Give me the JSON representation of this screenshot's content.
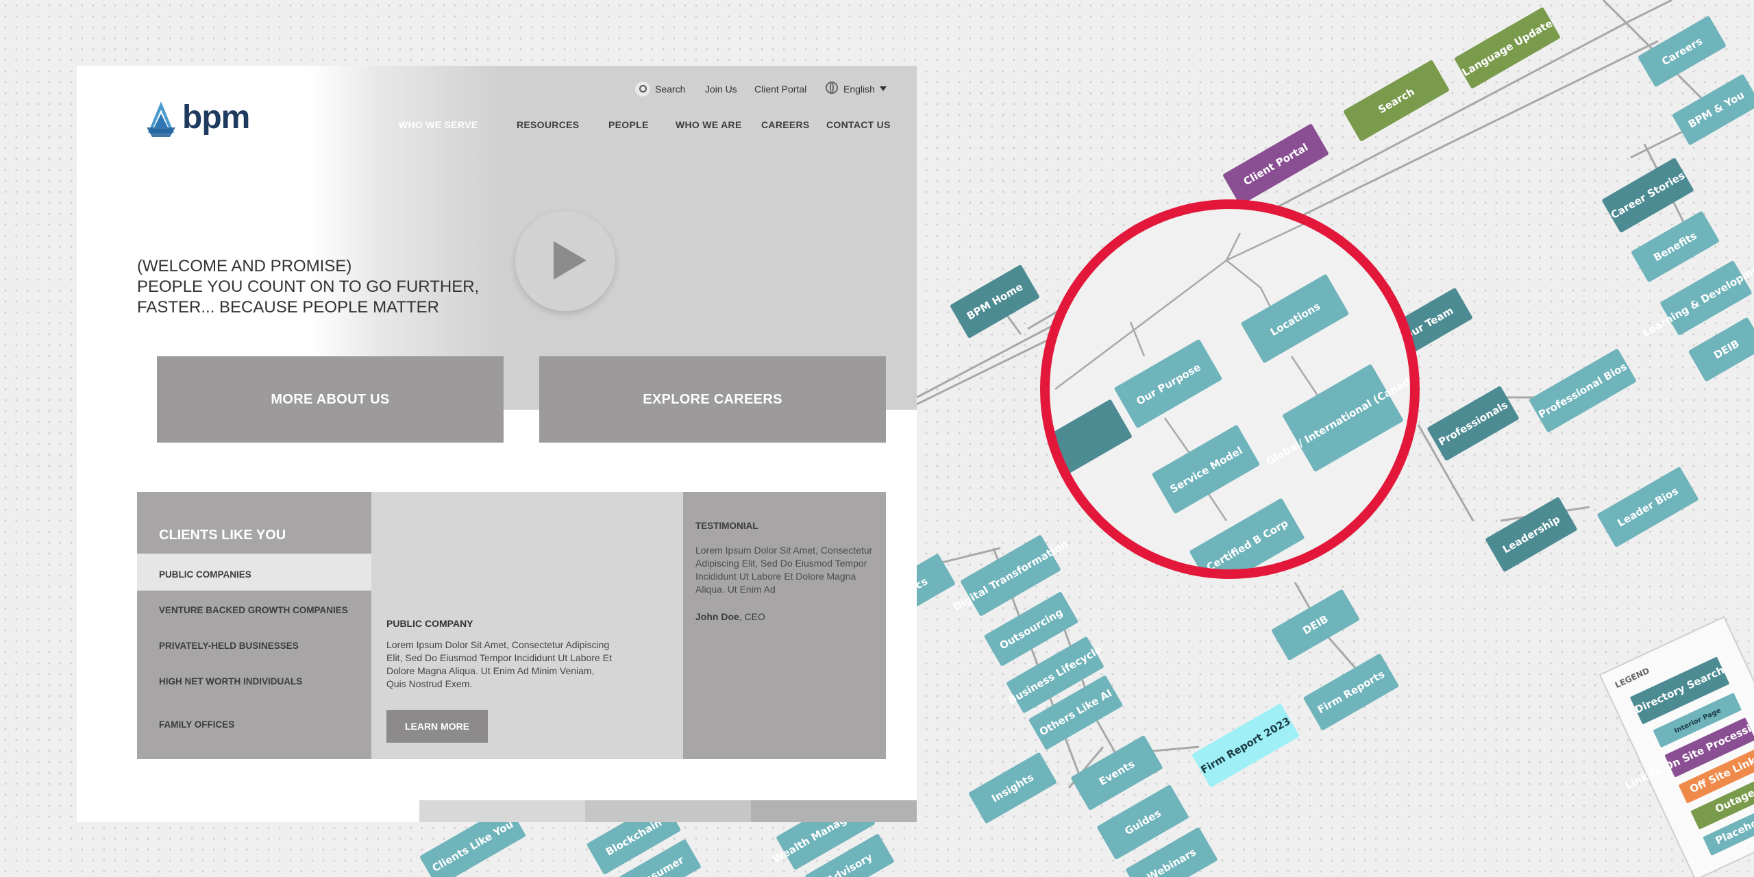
{
  "website": {
    "brand": "bpm",
    "utility_nav": {
      "search": "Search",
      "join": "Join Us",
      "portal": "Client Portal",
      "language": "English"
    },
    "main_nav": [
      "WHO WE SERVE",
      "RESOURCES",
      "PEOPLE",
      "WHO WE ARE",
      "CAREERS",
      "CONTACT US"
    ],
    "hero": {
      "line1": "(WELCOME AND PROMISE)",
      "line2": "PEOPLE YOU COUNT ON TO GO FURTHER,",
      "line3": "FASTER... BECAUSE PEOPLE MATTER"
    },
    "cta": {
      "more_about_us": "MORE ABOUT US",
      "explore_careers": "EXPLORE CAREERS"
    },
    "clients": {
      "title": "CLIENTS LIKE YOU",
      "items": [
        "PUBLIC COMPANIES",
        "VENTURE BACKED GROWTH COMPANIES",
        "PRIVATELY-HELD BUSINESSES",
        "HIGH NET WORTH INDIVIDUALS",
        "FAMILY OFFICES"
      ],
      "detail_title": "PUBLIC COMPANY",
      "detail_body": "Lorem Ipsum Dolor Sit Amet, Consectetur Adipiscing Elit, Sed Do Eiusmod Tempor Incididunt Ut Labore Et Dolore Magna Aliqua. Ut Enim Ad Minim Veniam, Quis Nostrud Exem.",
      "learn_more": "LEARN MORE"
    },
    "testimonial": {
      "title": "TESTIMONIAL",
      "body": "Lorem Ipsum Dolor Sit Amet, Consectetur Adipiscing Elit, Sed Do Eiusmod Tempor Incididunt Ut Labore Et Dolore Magna Aliqua. Ut Enim Ad",
      "author": "John Doe",
      "role": ", CEO"
    }
  },
  "sitemap": {
    "colors": {
      "teal": "#6fb3bb",
      "teal_dark": "#4d8b93",
      "green": "#7a9a4c",
      "purple": "#8a4f93",
      "cyan": "#9ef0f6",
      "orange": "#f08a4b",
      "highlight_ring": "#e3173a"
    },
    "nodes": {
      "careers": "Careers",
      "bpm_you": "BPM & You",
      "career_stories": "Career Stories",
      "benefits": "Benefits",
      "learning": "Learning & Development",
      "deib_top": "DEIB",
      "language_update": "Language Update",
      "search": "Search",
      "client_portal": "Client Portal",
      "bpm_home": "BPM Home",
      "our_purpose": "Our Purpose",
      "locations": "Locations",
      "service_model": "Service Model",
      "global": "Global/ International (Canada)",
      "certified_b_corp": "Certified B Corp",
      "deib": "DEIB",
      "firm_reports": "Firm Reports",
      "firm_report_2023": "Firm Report 2023",
      "our_team": "Our Team",
      "professionals": "Professionals",
      "professional_bios": "Professional Bios",
      "leadership": "Leadership",
      "leader_bios": "Leader Bios",
      "topics": "Topics",
      "digital": "Digital Transformation",
      "outsourcing": "Outsourcing",
      "business_lifecycle": "Business Lifecycle",
      "others_like_ai": "Others Like AI",
      "insights": "Insights",
      "events": "Events",
      "guides": "Guides",
      "webinars": "Webinars",
      "clients_like_you": "Clients Like You",
      "blockchain": "Blockchain",
      "consumer": "Consumer",
      "wealth_mgmt": "Wealth Management",
      "advisory": "Advisory"
    },
    "legend": {
      "title": "LEGEND",
      "directory": "Directory Search",
      "interior": "Interior Page",
      "link": "Link to On Site Processing Form",
      "off_site": "Off Site Link",
      "outage": "Outage",
      "placeholder": "Placeholder"
    }
  }
}
